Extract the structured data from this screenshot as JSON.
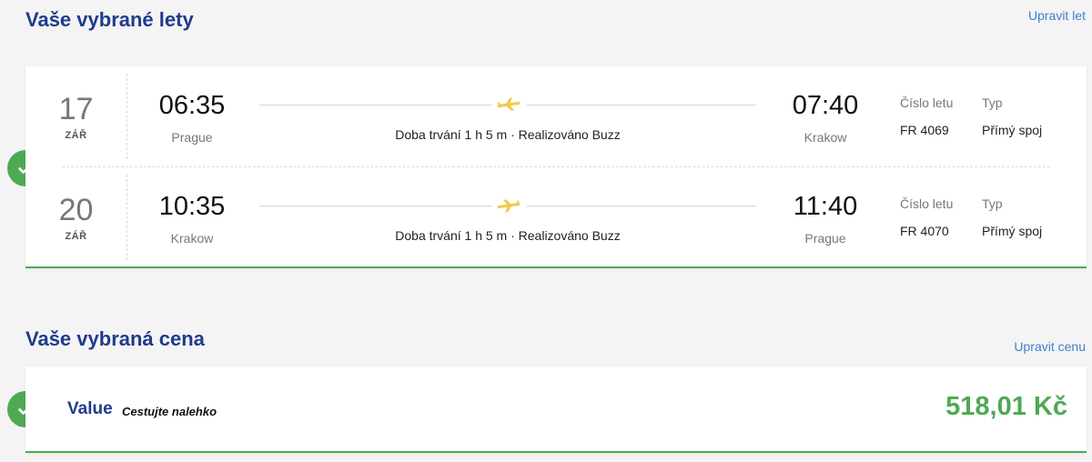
{
  "flights_section": {
    "title": "Vaše vybrané lety",
    "edit_label": "Upravit let",
    "flights": [
      {
        "day": "17",
        "month": "ZÁŘ",
        "departure_time": "06:35",
        "departure_city": "Prague",
        "arrival_time": "07:40",
        "arrival_city": "Krakow",
        "duration_text": "Doba trvání 1 h 5 m · Realizováno Buzz",
        "direction": "outbound",
        "flight_number_label": "Číslo letu",
        "flight_number": "FR 4069",
        "type_label": "Typ",
        "type": "Přímý spoj"
      },
      {
        "day": "20",
        "month": "ZÁŘ",
        "departure_time": "10:35",
        "departure_city": "Krakow",
        "arrival_time": "11:40",
        "arrival_city": "Prague",
        "duration_text": "Doba trvání 1 h 5 m · Realizováno Buzz",
        "direction": "return",
        "flight_number_label": "Číslo letu",
        "flight_number": "FR 4070",
        "type_label": "Typ",
        "type": "Přímý spoj"
      }
    ]
  },
  "price_section": {
    "title": "Vaše vybraná cena",
    "edit_label": "Upravit cenu",
    "fare_name": "Value",
    "fare_tagline": "Cestujte nalehko",
    "price": "518,01 Kč"
  },
  "icons": {
    "check": "check-circle-icon",
    "plane": "plane-icon"
  },
  "colors": {
    "heading": "#1f3b8c",
    "link": "#3d7fd1",
    "success": "#4ea954",
    "plane": "#f2c94c"
  }
}
